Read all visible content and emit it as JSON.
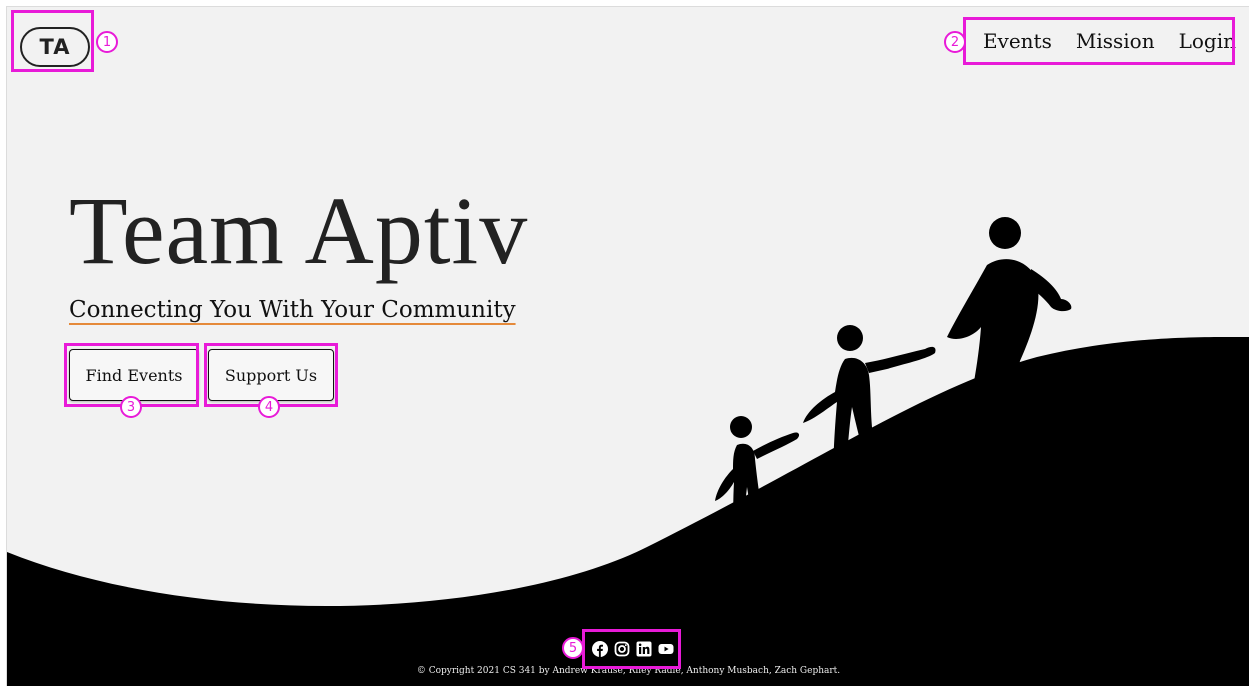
{
  "brand": {
    "logo_text": "TA"
  },
  "nav": {
    "items": [
      "Events",
      "Mission",
      "Login"
    ]
  },
  "hero": {
    "title": "Team Aptiv",
    "subtitle": "Connecting You With Your Community",
    "buttons": {
      "find": "Find Events",
      "support": "Support Us"
    }
  },
  "footer": {
    "social_icons": [
      "facebook-icon",
      "instagram-icon",
      "linkedin-icon",
      "youtube-icon"
    ],
    "copyright": "© Copyright 2021 CS 341 by Andrew Krause, Riley Radle, Anthony Musbach, Zach Gephart."
  },
  "annotations": {
    "color": "#e81bd8",
    "badges": [
      "1",
      "2",
      "3",
      "4",
      "5"
    ]
  },
  "colors": {
    "background": "#f2f2f2",
    "dark": "#000000",
    "accent_underline": "#e58a3a"
  }
}
